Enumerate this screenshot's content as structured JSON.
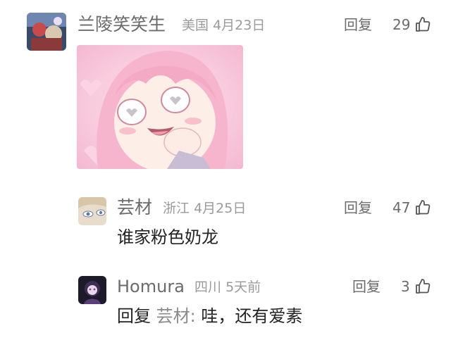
{
  "comments": [
    {
      "username": "兰陵笑笑生",
      "location": "美国",
      "date": "4月23日",
      "reply_label": "回复",
      "like_count": "29",
      "has_sticker": true
    },
    {
      "username": "芸材",
      "location": "浙江",
      "date": "4月25日",
      "reply_label": "回复",
      "like_count": "47",
      "text": "谁家粉色奶龙"
    },
    {
      "username": "Homura",
      "location": "四川",
      "date": "5天前",
      "reply_label": "回复",
      "like_count": "3",
      "reply_prefix": "回复",
      "reply_to": "芸材:",
      "text": "哇，还有爱素"
    }
  ],
  "colors": {
    "name": "#6b6b6b",
    "meta": "#9a9a9a",
    "body": "#222222",
    "sticker_pink": "#f6c6da"
  },
  "icons": {
    "like": "thumbs-up-icon"
  }
}
